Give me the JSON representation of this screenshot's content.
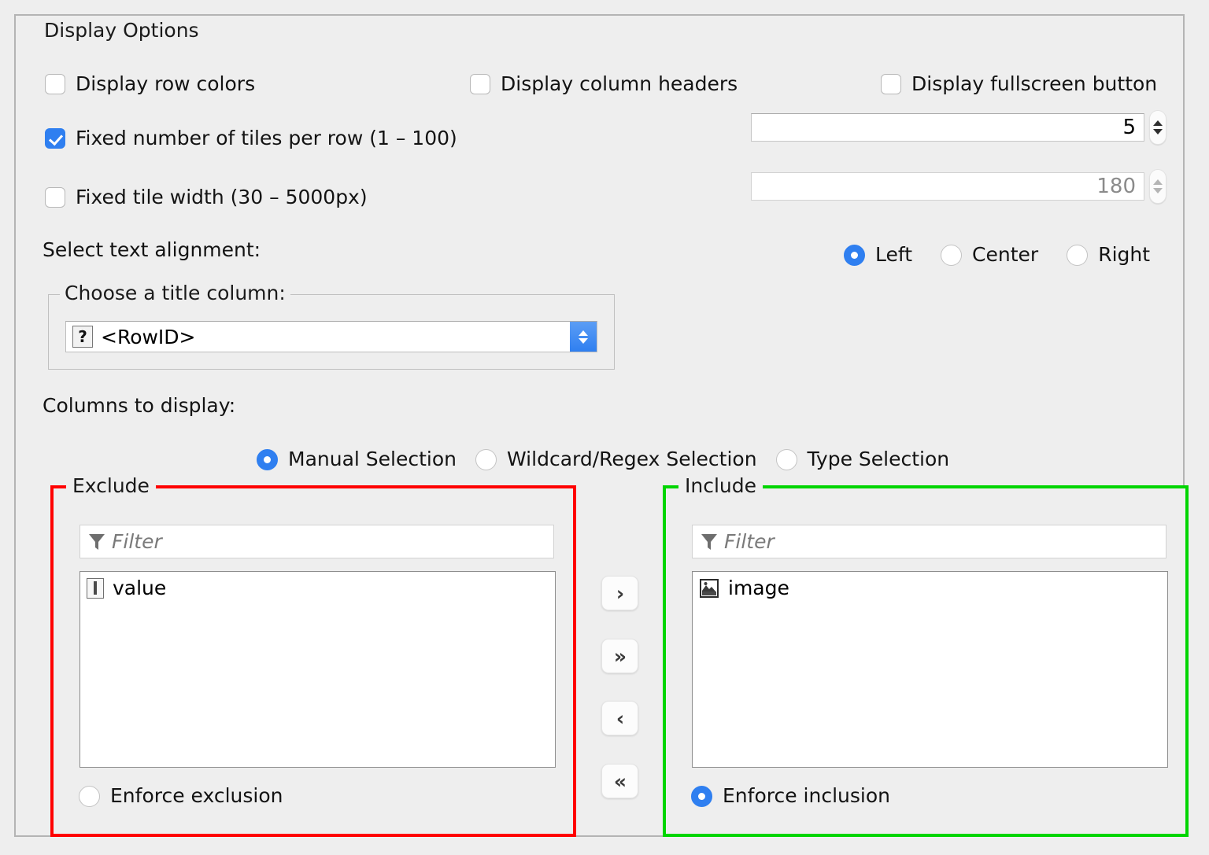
{
  "group": {
    "title": "Display Options"
  },
  "checkboxes": [
    {
      "label": "Display row colors",
      "checked": false
    },
    {
      "label": "Display column headers",
      "checked": false
    },
    {
      "label": "Display fullscreen button",
      "checked": false
    },
    {
      "label": "Fixed number of tiles per row (1 – 100)",
      "checked": true
    },
    {
      "label": "Fixed tile width (30 – 5000px)",
      "checked": false
    }
  ],
  "spinners": [
    {
      "value": "5",
      "disabled": false
    },
    {
      "value": "180",
      "disabled": true
    }
  ],
  "alignment": {
    "label": "Select text alignment:",
    "options": [
      {
        "label": "Left",
        "selected": true
      },
      {
        "label": "Center",
        "selected": false
      },
      {
        "label": "Right",
        "selected": false
      }
    ]
  },
  "title_column": {
    "legend": "Choose a title column:",
    "icon": "question-mark-icon",
    "value": "<RowID>"
  },
  "columns_to_display": {
    "label": "Columns to display:",
    "modes": [
      {
        "label": "Manual Selection",
        "selected": true
      },
      {
        "label": "Wildcard/Regex Selection",
        "selected": false
      },
      {
        "label": "Type Selection",
        "selected": false
      }
    ]
  },
  "exclude_panel": {
    "legend": "Exclude",
    "border_color": "#ff0000",
    "filter_placeholder": "Filter",
    "items": [
      {
        "label": "value",
        "icon": "string-type-icon"
      }
    ],
    "enforce": {
      "label": "Enforce exclusion",
      "selected": false
    }
  },
  "include_panel": {
    "legend": "Include",
    "border_color": "#00d500",
    "filter_placeholder": "Filter",
    "items": [
      {
        "label": "image",
        "icon": "image-type-icon"
      }
    ],
    "enforce": {
      "label": "Enforce inclusion",
      "selected": true
    }
  },
  "transfer_buttons": [
    {
      "label": "›",
      "name": "move-right-button"
    },
    {
      "label": "»",
      "name": "move-all-right-button"
    },
    {
      "label": "‹",
      "name": "move-left-button"
    },
    {
      "label": "«",
      "name": "move-all-left-button"
    }
  ],
  "colors": {
    "accent": "#2f7ff0",
    "background": "#eeeeee",
    "exclude": "#ff0000",
    "include": "#00d500"
  }
}
